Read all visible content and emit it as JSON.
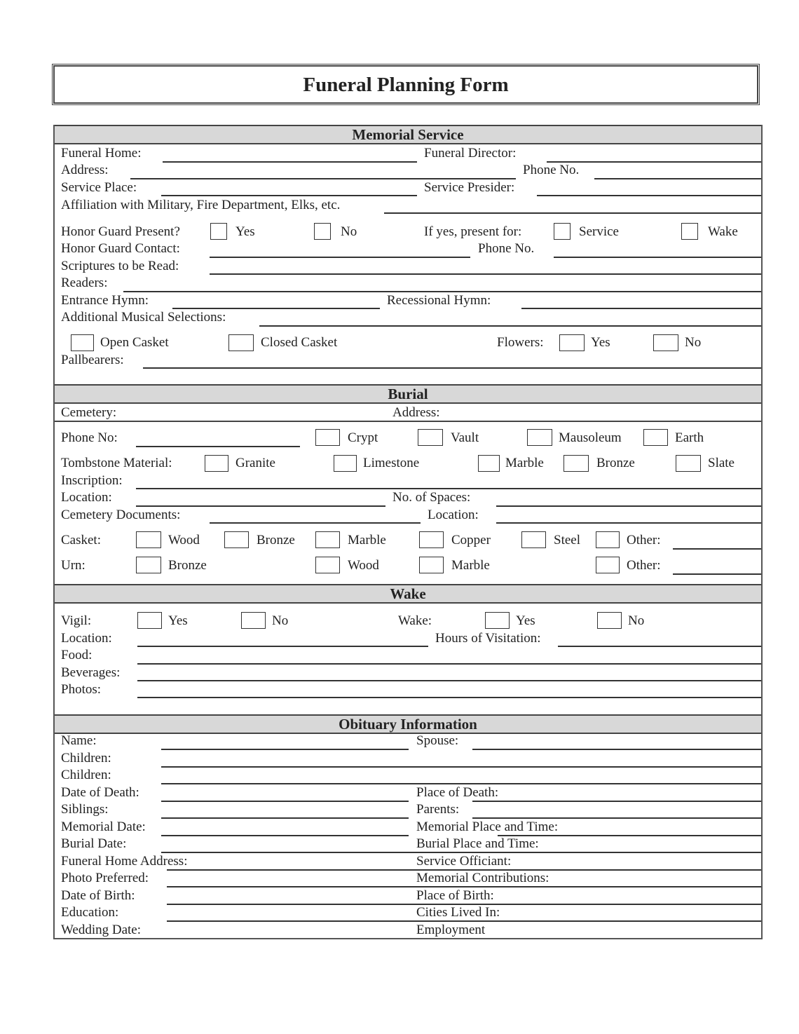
{
  "title": "Funeral Planning Form",
  "memorial_service": {
    "header": "Memorial Service",
    "funeral_home": "Funeral Home:",
    "funeral_director": "Funeral Director:",
    "address": "Address:",
    "phone_no": "Phone No.",
    "service_place": "Service Place:",
    "service_presider": "Service Presider:",
    "affiliation": "Affiliation with Military, Fire Department, Elks, etc.",
    "honor_guard_present": "Honor Guard Present?",
    "yes": "Yes",
    "no": "No",
    "if_yes_present_for": "If yes, present for:",
    "service": "Service",
    "wake": "Wake",
    "honor_guard_contact": "Honor Guard Contact:",
    "phone_no_2": "Phone No.",
    "scriptures": "Scriptures to be Read:",
    "readers": "Readers:",
    "entrance_hymn": "Entrance Hymn:",
    "recessional_hymn": "Recessional Hymn:",
    "additional_music": "Additional Musical Selections:",
    "open_casket": "Open Casket",
    "closed_casket": "Closed Casket",
    "flowers": "Flowers:",
    "flowers_yes": "Yes",
    "flowers_no": "No",
    "pallbearers": "Pallbearers:"
  },
  "burial": {
    "header": "Burial",
    "cemetery": "Cemetery:",
    "address": "Address:",
    "phone_no": "Phone No:",
    "types": [
      "Crypt",
      "Vault",
      "Mausoleum",
      "Earth"
    ],
    "tombstone_material": "Tombstone Material:",
    "materials": [
      "Granite",
      "Limestone",
      "Marble",
      "Bronze",
      "Slate"
    ],
    "inscription": "Inscription:",
    "location": "Location:",
    "no_of_spaces": "No. of Spaces:",
    "cemetery_documents": "Cemetery Documents:",
    "location_2": "Location:",
    "casket": "Casket:",
    "casket_options": [
      "Wood",
      "Bronze",
      "Marble",
      "Copper",
      "Steel",
      "Other:"
    ],
    "urn": "Urn:",
    "urn_options": [
      "Bronze",
      "Wood",
      "Marble",
      "Other:"
    ]
  },
  "wake": {
    "header": "Wake",
    "vigil": "Vigil:",
    "vigil_yes": "Yes",
    "vigil_no": "No",
    "wake": "Wake:",
    "wake_yes": "Yes",
    "wake_no": "No",
    "location": "Location:",
    "hours_of_visitation": "Hours of Visitation:",
    "food": "Food:",
    "beverages": "Beverages:",
    "photos": "Photos:"
  },
  "obituary": {
    "header": "Obituary Information",
    "left": [
      "Name:",
      "Children:",
      "Children:",
      "Date of Death:",
      "Siblings:",
      "Memorial Date:",
      "Burial Date:",
      "Funeral Home Address:",
      "Photo Preferred:",
      "Date of Birth:",
      "Education:",
      "Wedding Date:"
    ],
    "right": [
      "Spouse:",
      "",
      "",
      "Place of Death:",
      "Parents:",
      "Memorial Place and Time:",
      "Burial Place and Time:",
      "Service Officiant:",
      "Memorial Contributions:",
      "Place of Birth:",
      "Cities Lived In:",
      "Employment"
    ]
  }
}
